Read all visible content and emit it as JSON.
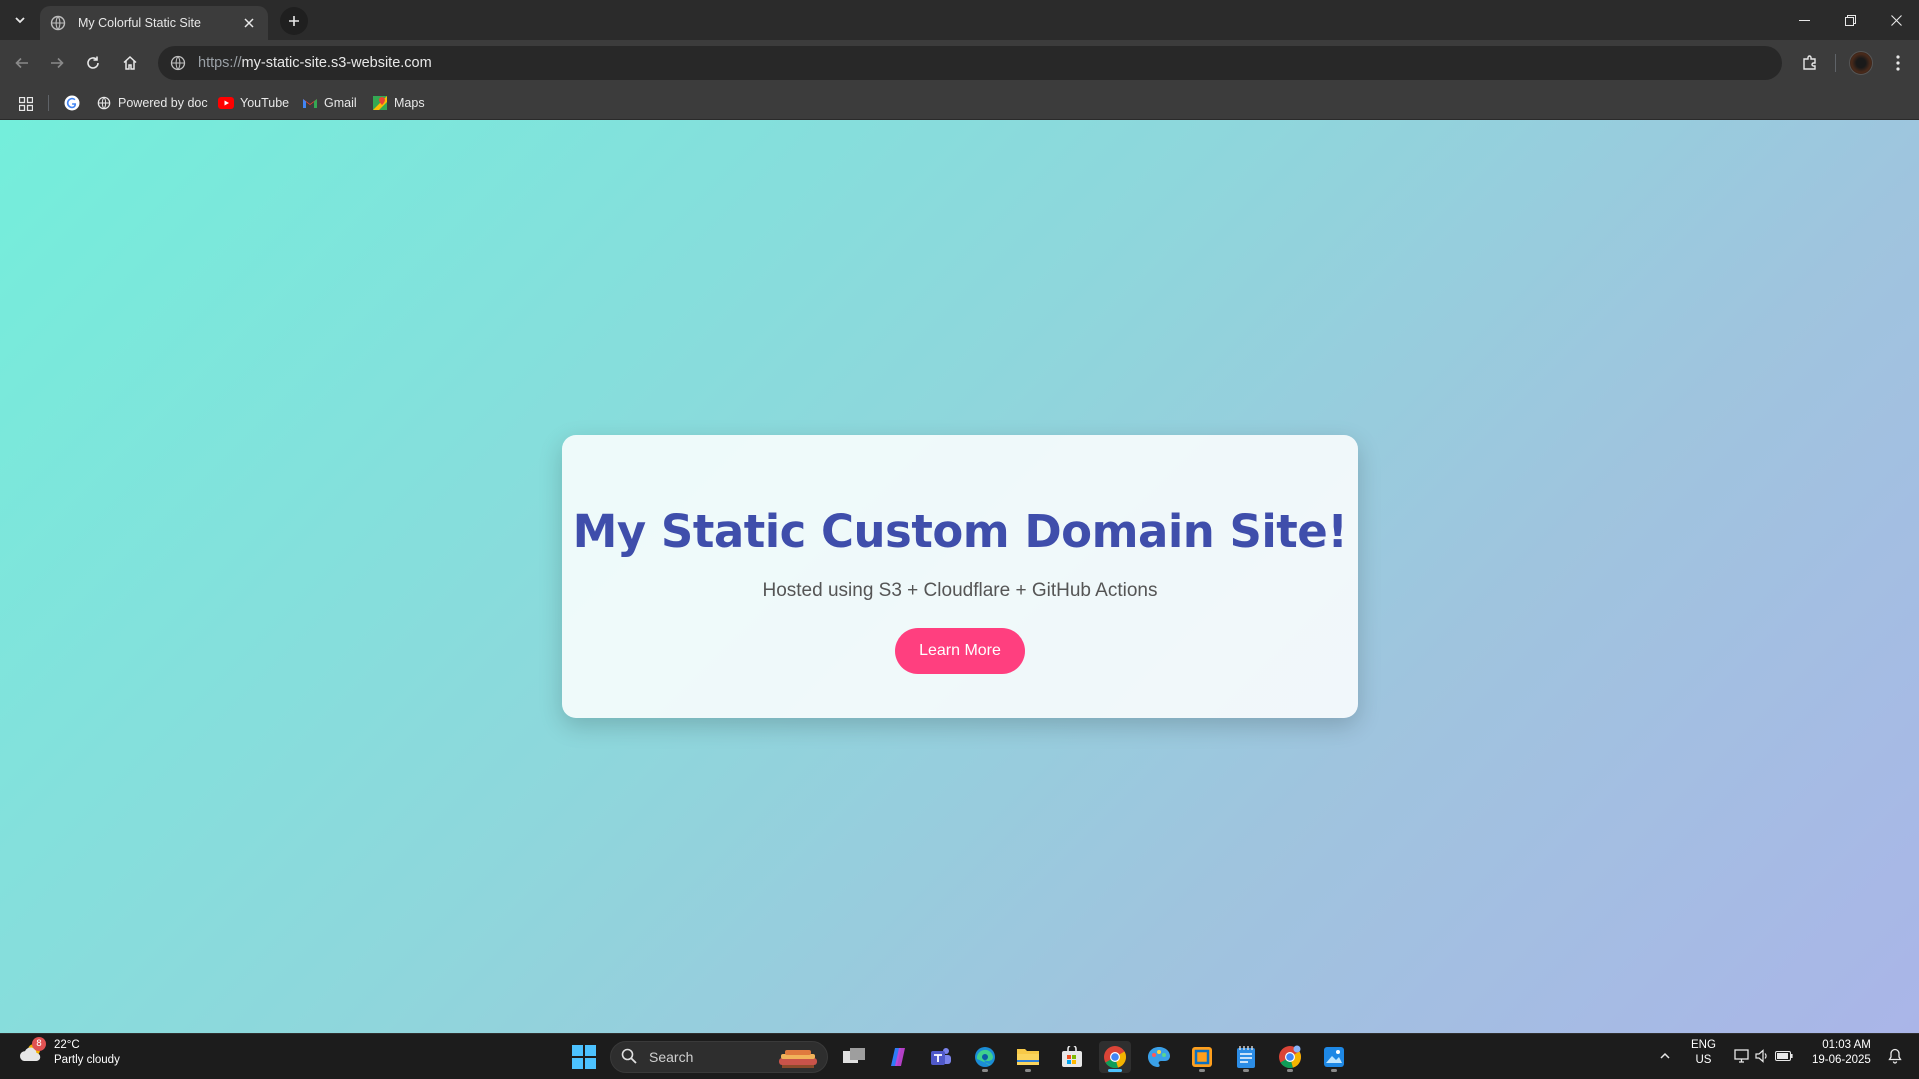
{
  "browser": {
    "tab_title": "My Colorful Static Site",
    "url_scheme": "https://",
    "url_host": "my-static-site.s3-website.com",
    "bookmarks": [
      {
        "label": ""
      },
      {
        "label": "Powered by doc"
      },
      {
        "label": "YouTube"
      },
      {
        "label": "Gmail"
      },
      {
        "label": "Maps"
      }
    ]
  },
  "page": {
    "heading": "My Static Custom Domain Site!",
    "subtitle": "Hosted using S3 + Cloudflare + GitHub Actions",
    "button_label": "Learn More",
    "colors": {
      "heading": "#3f4eab",
      "button": "#ff3f7f",
      "gradient_start": "#74eedb",
      "gradient_end": "#aab5e8"
    }
  },
  "taskbar": {
    "weather": {
      "temp": "22°C",
      "condition": "Partly cloudy",
      "badge": "8"
    },
    "search_label": "Search",
    "language": {
      "line1": "ENG",
      "line2": "US"
    },
    "clock": {
      "time": "01:03 AM",
      "date": "19-06-2025"
    },
    "apps": [
      "task-view",
      "copilot",
      "teams",
      "edge",
      "file-explorer",
      "microsoft-store",
      "chrome",
      "paint",
      "remote-desktop",
      "notepad",
      "chrome-beta",
      "photos"
    ]
  }
}
